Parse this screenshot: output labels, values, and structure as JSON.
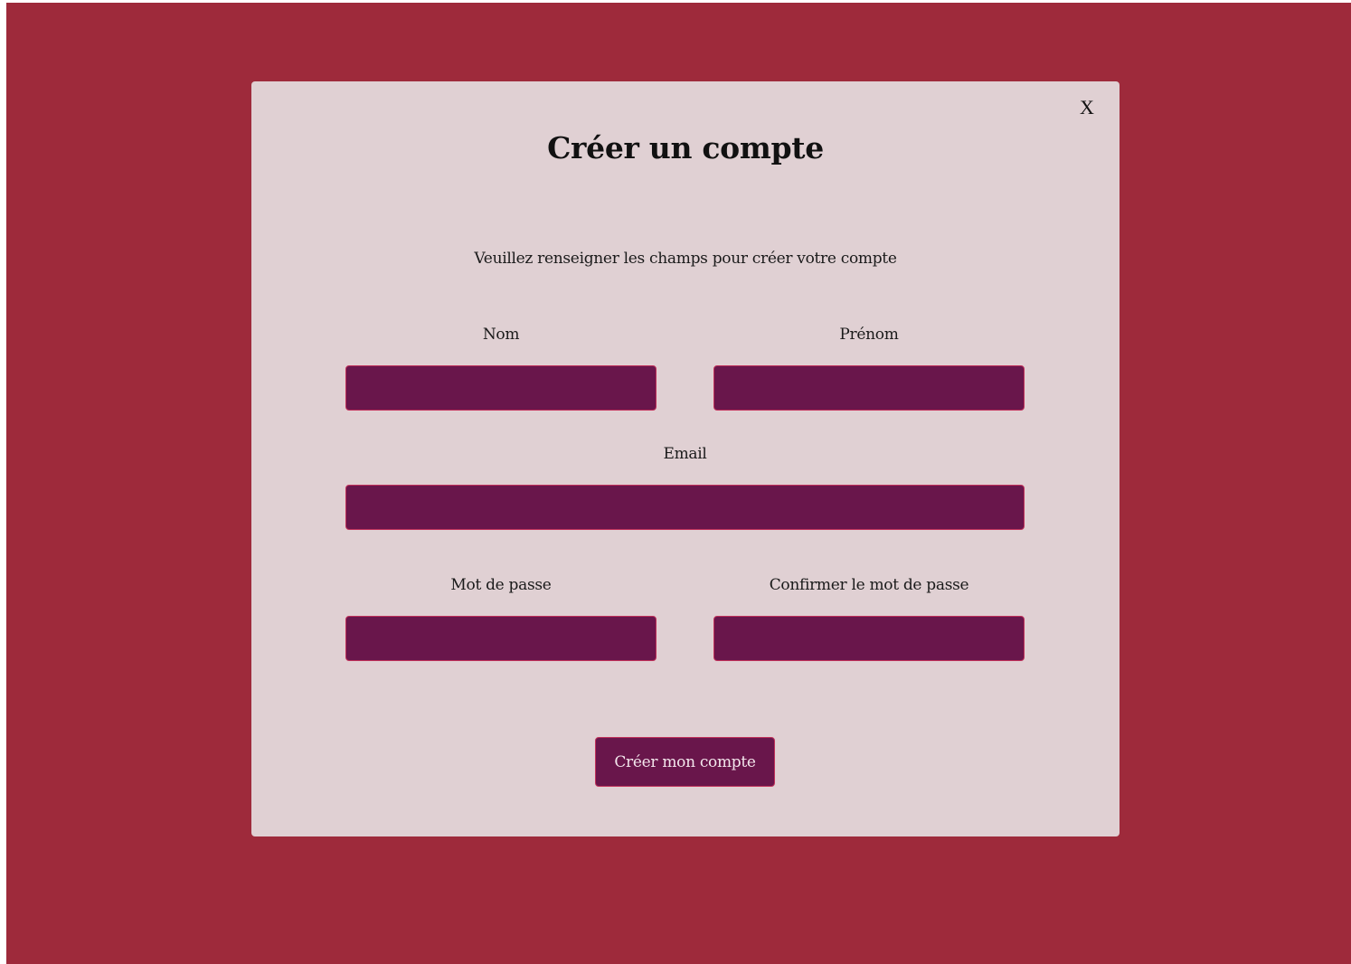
{
  "modal": {
    "close_label": "X",
    "title": "Créer un compte",
    "subtitle": "Veuillez renseigner les champs pour créer votre compte"
  },
  "form": {
    "nom": {
      "label": "Nom",
      "value": ""
    },
    "prenom": {
      "label": "Prénom",
      "value": ""
    },
    "email": {
      "label": "Email",
      "value": ""
    },
    "password": {
      "label": "Mot de passe",
      "value": ""
    },
    "confirm_password": {
      "label": "Confirmer le mot de passe",
      "value": ""
    },
    "submit_label": "Créer mon compte"
  },
  "colors": {
    "backdrop": "#9e2a3b",
    "modal_background": "#e0d0d3",
    "field_background": "#69164b",
    "field_border": "#c0305a"
  }
}
